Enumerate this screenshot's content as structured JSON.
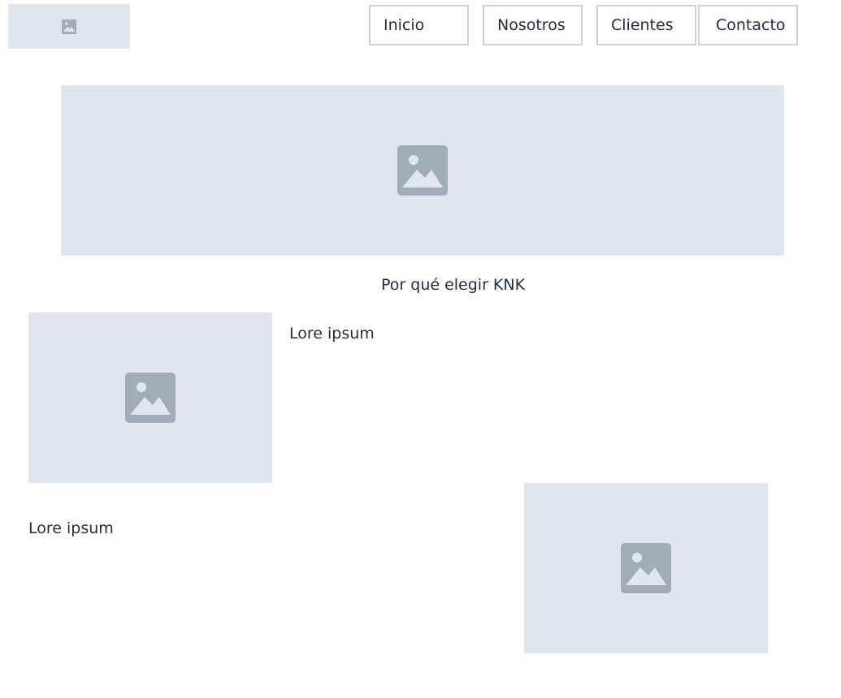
{
  "header": {
    "logo_icon": "image-placeholder-icon",
    "nav": [
      {
        "label": "Inicio"
      },
      {
        "label": "Nosotros"
      },
      {
        "label": "Clientes"
      },
      {
        "label": "Contacto"
      }
    ]
  },
  "hero": {
    "icon": "image-placeholder-icon"
  },
  "section": {
    "title": "Por qué elegir KNK",
    "rows": [
      {
        "text": "Lore ipsum",
        "icon": "image-placeholder-icon"
      },
      {
        "text": "Lore ipsum",
        "icon": "image-placeholder-icon"
      }
    ]
  },
  "colors": {
    "placeholder_bg": "#e0e6ed",
    "placeholder_icon": "#a0adb8",
    "nav_border": "#c9d3de",
    "text": "#1f2d3d"
  }
}
